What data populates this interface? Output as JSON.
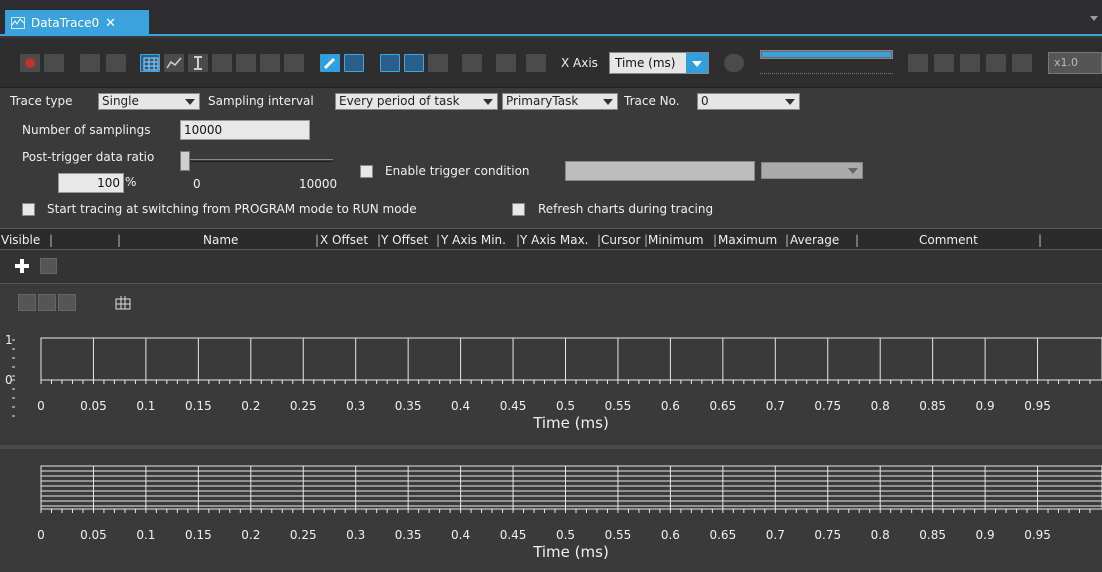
{
  "tab": {
    "title": "DataTrace0",
    "close_glyph": "✕",
    "icon": "trace-icon"
  },
  "toolbar": {
    "x_axis_label": "X Axis",
    "x_axis_value": "Time (ms)",
    "speed_value": "x1.0",
    "zoom_level_fraction": 1.0
  },
  "settings": {
    "trace_type_label": "Trace type",
    "trace_type_value": "Single",
    "sampling_interval_label": "Sampling interval",
    "sampling_interval_value": "Every period of task",
    "task_value": "PrimaryTask",
    "trace_no_label": "Trace No.",
    "trace_no_value": "0",
    "num_samplings_label": "Number of samplings",
    "num_samplings_value": "10000",
    "post_trigger_label": "Post-trigger data ratio",
    "post_trigger_value": "100",
    "post_trigger_unit": "%",
    "slider_min": "0",
    "slider_max": "10000",
    "post_trigger_fraction": 0,
    "enable_trigger_label": "Enable trigger condition",
    "start_tracing_label": "Start tracing at switching from PROGRAM mode to RUN mode",
    "refresh_charts_label": "Refresh charts during tracing"
  },
  "table": {
    "columns": [
      "Visible",
      "Name",
      "X Offset",
      "Y Offset",
      "Y Axis Min.",
      "Y Axis Max.",
      "Cursor",
      "Minimum",
      "Maximum",
      "Average",
      "Comment"
    ]
  },
  "chart_data": [
    {
      "type": "line",
      "title": "",
      "xlabel": "Time (ms)",
      "ylabel": "",
      "xlim": [
        0,
        1.0
      ],
      "ylim": [
        0,
        1
      ],
      "x_ticks": [
        "0",
        "0.05",
        "0.1",
        "0.15",
        "0.2",
        "0.25",
        "0.3",
        "0.35",
        "0.4",
        "0.45",
        "0.5",
        "0.55",
        "0.6",
        "0.65",
        "0.7",
        "0.75",
        "0.8",
        "0.85",
        "0.9",
        "0.95"
      ],
      "y_ticks": [
        "0",
        "1"
      ],
      "grid": true,
      "series": []
    },
    {
      "type": "line",
      "title": "",
      "xlabel": "Time (ms)",
      "ylabel": "",
      "xlim": [
        0,
        1.0
      ],
      "x_ticks": [
        "0",
        "0.05",
        "0.1",
        "0.15",
        "0.2",
        "0.25",
        "0.3",
        "0.35",
        "0.4",
        "0.45",
        "0.5",
        "0.55",
        "0.6",
        "0.65",
        "0.7",
        "0.75",
        "0.8",
        "0.85",
        "0.9",
        "0.95"
      ],
      "grid": true,
      "series": []
    }
  ],
  "colors": {
    "accent": "#3aa3de",
    "panel": "#3a3a3a",
    "toolbar": "#2e2e2e",
    "grid": "#e8e8e8"
  }
}
